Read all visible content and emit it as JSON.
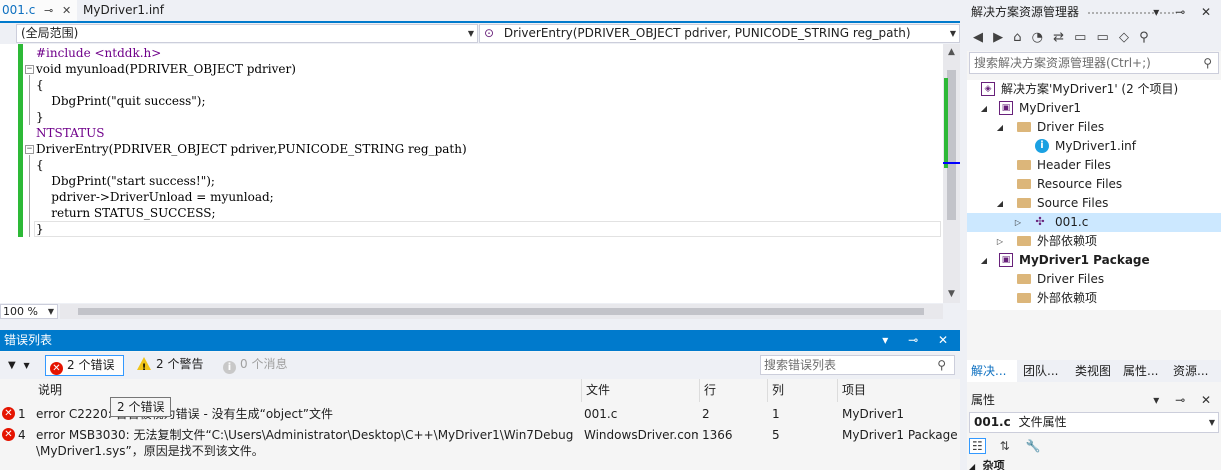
{
  "doc_tabs": [
    {
      "label": "001.c",
      "pin": "⊸",
      "close": "✕"
    },
    {
      "label": "MyDriver1.inf"
    }
  ],
  "nav": {
    "scope": "(全局范围)",
    "function_icon": "⊙",
    "function": "DriverEntry(PDRIVER_OBJECT pdriver, PUNICODE_STRING reg_path)"
  },
  "code": [
    "#include <ntddk.h>",
    "void myunload(PDRIVER_OBJECT pdriver)",
    "{",
    "    DbgPrint(\"quit success\");",
    "}",
    "NTSTATUS",
    "DriverEntry(PDRIVER_OBJECT pdriver,PUNICODE_STRING reg_path)",
    "{",
    "    DbgPrint(\"start success!\");",
    "    pdriver->DriverUnload = myunload;",
    "    return STATUS_SUCCESS;",
    "}"
  ],
  "zoom": "100 %",
  "error_list": {
    "title": "错误列表",
    "title_buttons": "▾ ⊸ ✕",
    "filter_icon": "▼",
    "errors_btn": "2 个错误",
    "warnings_btn": "2 个警告",
    "messages_btn": "0 个消息",
    "search_placeholder": "搜索错误列表",
    "columns": [
      "说明",
      "文件",
      "行",
      "列",
      "项目"
    ],
    "rows": [
      {
        "num": "1",
        "desc": "error C2220: 警告被视为错误 - 没有生成“object”文件",
        "file": "001.c",
        "line": "2",
        "col": "1",
        "project": "MyDriver1"
      },
      {
        "num": "4",
        "desc": "error MSB3030: 无法复制文件“C:\\Users\\Administrator\\Desktop\\C++\\MyDriver1\\Win7Debug",
        "desc2": "\\MyDriver1.sys”，原因是找不到该文件。",
        "file": "WindowsDriver.common.targets",
        "line": "1366",
        "col": "5",
        "project": "MyDriver1 Package"
      }
    ],
    "tooltip": "2 个错误"
  },
  "solution_explorer": {
    "title": "解决方案资源管理器",
    "title_buttons": "▾ ⊸ ✕",
    "toolbar": "◀ ▶ ⌂ ◔ ⇄ ▭ ▭ ◇ ⚲",
    "search_placeholder": "搜索解决方案资源管理器(Ctrl+;)",
    "tree": [
      {
        "label": "解决方案'MyDriver1' (2 个项目)"
      },
      {
        "label": "MyDriver1"
      },
      {
        "label": "Driver Files"
      },
      {
        "label": "MyDriver1.inf"
      },
      {
        "label": "Header Files"
      },
      {
        "label": "Resource Files"
      },
      {
        "label": "Source Files"
      },
      {
        "label": "001.c"
      },
      {
        "label": "外部依赖项"
      },
      {
        "label": "MyDriver1 Package"
      },
      {
        "label": "Driver Files"
      },
      {
        "label": "外部依赖项"
      }
    ],
    "tabs": [
      "解决...",
      "团队...",
      "类视图",
      "属性...",
      "资源..."
    ]
  },
  "properties": {
    "title": "属性",
    "title_buttons": "▾ ⊸ ✕",
    "object": "001.c",
    "object_type": "文件属性",
    "section": "杂项"
  }
}
